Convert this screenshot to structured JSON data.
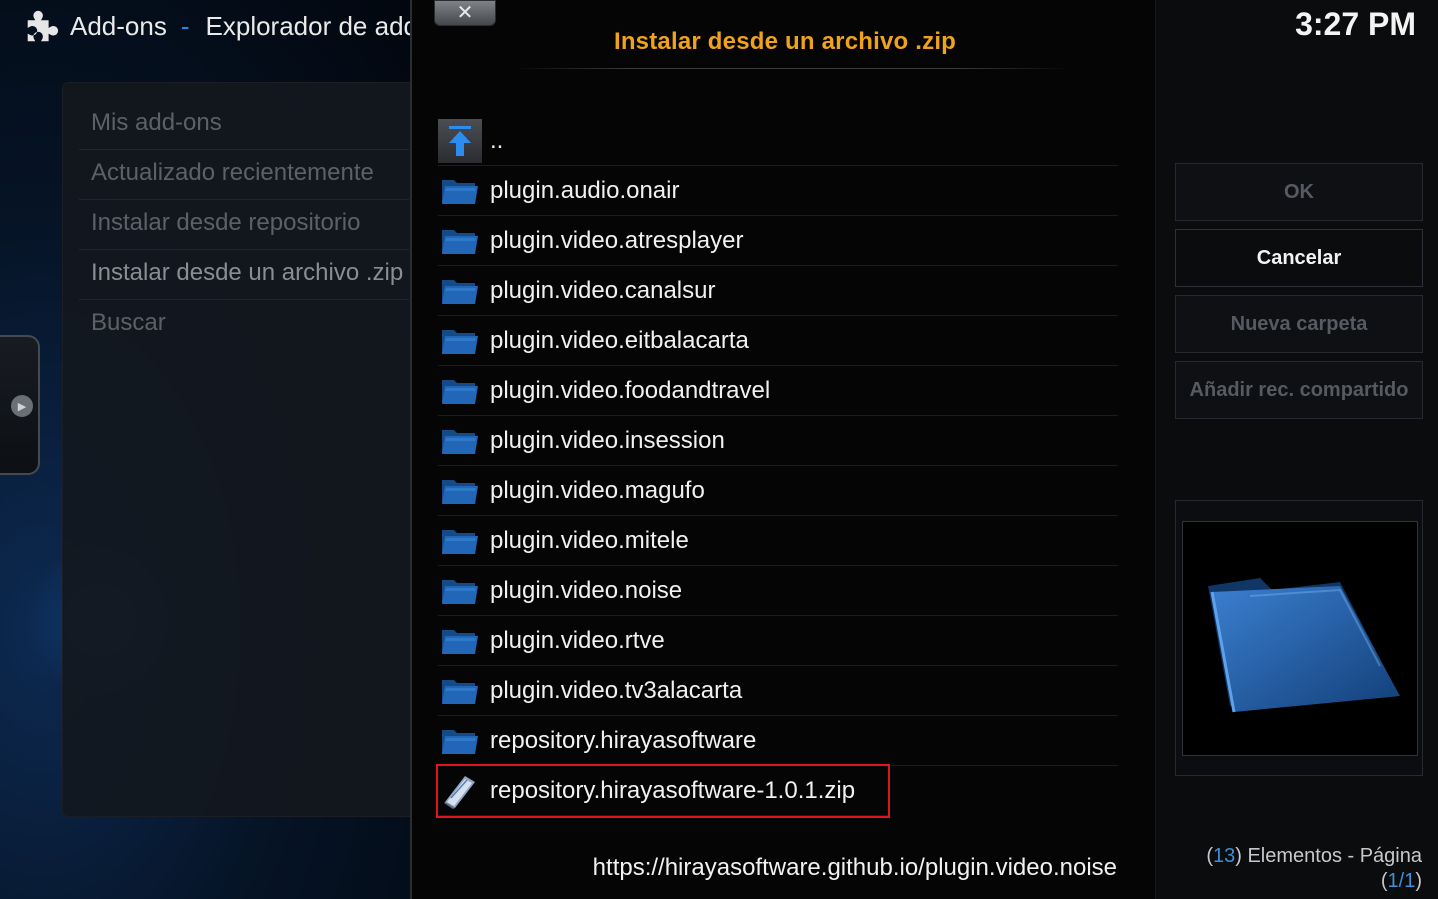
{
  "header": {
    "section": "Add-ons",
    "separator": "-",
    "breadcrumb": "Explorador de add-ons"
  },
  "menu": {
    "items": [
      {
        "label": "Mis add-ons"
      },
      {
        "label": "Actualizado recientemente"
      },
      {
        "label": "Instalar desde repositorio"
      },
      {
        "label": "Instalar desde un archivo .zip"
      },
      {
        "label": "Buscar"
      }
    ]
  },
  "dialog": {
    "close_label": "✕",
    "title": "Instalar desde un archivo .zip",
    "files": [
      {
        "label": "..",
        "icon": "parent-folder-icon"
      },
      {
        "label": "plugin.audio.onair",
        "icon": "folder-icon"
      },
      {
        "label": "plugin.video.atresplayer",
        "icon": "folder-icon"
      },
      {
        "label": "plugin.video.canalsur",
        "icon": "folder-icon"
      },
      {
        "label": "plugin.video.eitbalacarta",
        "icon": "folder-icon"
      },
      {
        "label": "plugin.video.foodandtravel",
        "icon": "folder-icon"
      },
      {
        "label": "plugin.video.insession",
        "icon": "folder-icon"
      },
      {
        "label": "plugin.video.magufo",
        "icon": "folder-icon"
      },
      {
        "label": "plugin.video.mitele",
        "icon": "folder-icon"
      },
      {
        "label": "plugin.video.noise",
        "icon": "folder-icon"
      },
      {
        "label": "plugin.video.rtve",
        "icon": "folder-icon"
      },
      {
        "label": "plugin.video.tv3alacarta",
        "icon": "folder-icon"
      },
      {
        "label": "repository.hirayasoftware",
        "icon": "folder-icon"
      },
      {
        "label": "repository.hirayasoftware-1.0.1.zip",
        "icon": "zip-file-icon"
      }
    ],
    "current_path": "https://hirayasoftware.github.io/plugin.video.noise"
  },
  "right": {
    "clock": "3:27 PM",
    "buttons": {
      "ok": "OK",
      "cancel": "Cancelar",
      "new_folder": "Nueva carpeta",
      "add_share": "Añadir rec. compartido"
    },
    "count": "13",
    "elements_label": "Elementos - Página",
    "page": "1/1"
  },
  "colors": {
    "title_accent": "#f0a31a",
    "selection_outline": "#e0141e",
    "info_accent": "#3e8fd8",
    "folder_blue": "#1f5fa8"
  }
}
